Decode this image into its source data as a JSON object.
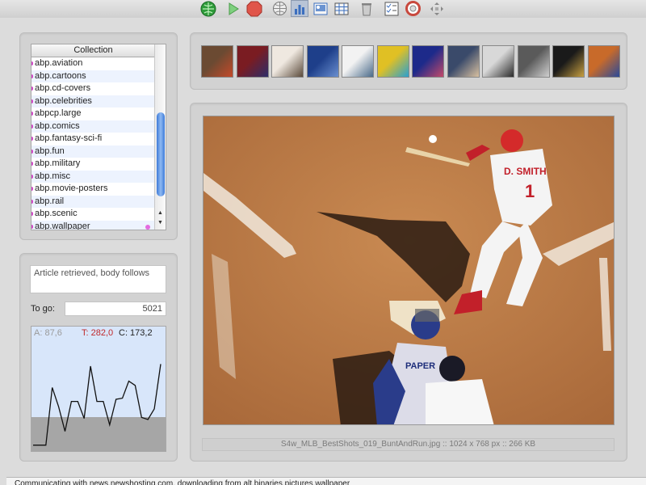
{
  "toolbar": {
    "buttons": [
      {
        "name": "connect-globe-icon",
        "color": "#2e9b3a"
      },
      {
        "name": "play-icon",
        "color": "#6cc56c"
      },
      {
        "name": "stop-icon",
        "color": "#d84b3c"
      },
      {
        "name": "globe-icon",
        "color": "#777777"
      },
      {
        "name": "bar-chart-icon",
        "color": "#3c6fbf"
      },
      {
        "name": "image-preview-icon",
        "color": "#3c6fbf"
      },
      {
        "name": "grid-icon",
        "color": "#3c6fbf"
      },
      {
        "name": "trash-icon",
        "color": "#888888"
      },
      {
        "name": "checklist-icon",
        "color": "#3c6fbf"
      },
      {
        "name": "lifebuoy-icon",
        "color": "#c8493e"
      },
      {
        "name": "move-arrows-icon",
        "color": "#888888"
      }
    ]
  },
  "collection": {
    "header": "Collection",
    "items": [
      "abp.aviation",
      "abp.cartoons",
      "abp.cd-covers",
      "abp.celebrities",
      "abpcp.large",
      "abp.comics",
      "abp.fantasy-sci-fi",
      "abp.fun",
      "abp.military",
      "abp.misc",
      "abp.movie-posters",
      "abp.rail",
      "abp.scenic",
      "abp.wallpaper"
    ]
  },
  "status": {
    "message": "Article retrieved, body follows",
    "togo_label": "To go:",
    "togo_value": "5021"
  },
  "graph": {
    "a_label": "A: 87,6",
    "t_label": "T: 282,0",
    "c_label": "C: 173,2",
    "line_values": [
      4,
      4,
      4,
      58,
      40,
      17,
      45,
      45,
      29,
      78,
      45,
      45,
      23,
      47,
      48,
      64,
      60,
      30,
      28,
      38,
      80
    ]
  },
  "thumbnails": [
    "fantasy-art-thumbnail",
    "comic-girl-thumbnail",
    "sci-fi-scene-thumbnail",
    "blue-night-thumbnail",
    "scenic-lake-thumbnail",
    "colorful-art-thumbnail",
    "masked-figure-thumbnail",
    "portrait-man-thumbnail",
    "aircraft-thumbnail",
    "train-thumbnail",
    "crowd-event-thumbnail",
    "baseball-catch-thumbnail"
  ],
  "main_image": {
    "caption": "S4w_MLB_BestShots_019_BuntAndRun.jpg :: 1024 x 768 px :: 266 KB",
    "jersey_text": "D. SMITH",
    "jersey_number": "1",
    "catcher_jersey": "PAPER"
  },
  "statusbar": {
    "text": "Communicating with news.newshosting.com, downloading from alt.binaries.pictures.wallpaper"
  }
}
